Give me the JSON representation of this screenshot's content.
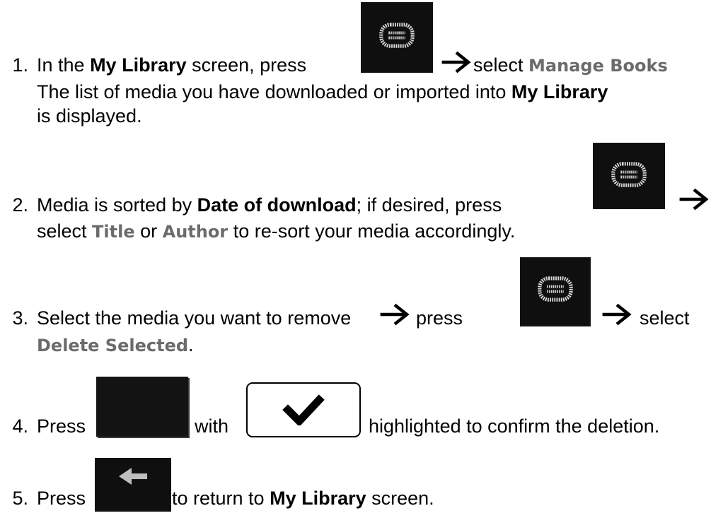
{
  "steps": [
    {
      "number": "1.",
      "text_a": "In the ",
      "bold_a": "My Library",
      "text_b": " screen, press ",
      "text_c": " select ",
      "ui_a": "Manage Books",
      "line2_a": "The list of media you have downloaded or imported into ",
      "line2_bold": "My Library",
      "line3": "is displayed."
    },
    {
      "number": "2.",
      "text_a": "Media is sorted by ",
      "bold_a": "Date of download",
      "text_b": "; if desired, press",
      "line2_a": "select ",
      "ui_a": "Title",
      "line2_b": " or ",
      "ui_b": "Author",
      "line2_c": " to re-sort your media accordingly."
    },
    {
      "number": "3.",
      "text_a": "Select the media you want to remove",
      "text_b": "press",
      "text_c": "select",
      "ui_a": "Delete Selected",
      "line2_end": "."
    },
    {
      "number": "4.",
      "text_a": "Press",
      "text_b": "with",
      "text_c": "highlighted to confirm the deletion."
    },
    {
      "number": "5.",
      "text_a": "Press",
      "text_b": " to return to ",
      "bold_a": "My Library",
      "text_c": " screen."
    }
  ],
  "icons": {
    "menu_key": "menu-key-icon",
    "arrow": "right-arrow-icon",
    "confirm_key": "confirm-key-icon",
    "checkmark": "checkmark-icon",
    "back_key": "back-key-icon"
  },
  "colors": {
    "text": "#000000",
    "ui_label": "#6b6b6b",
    "key_background": "#0f0f0f"
  }
}
